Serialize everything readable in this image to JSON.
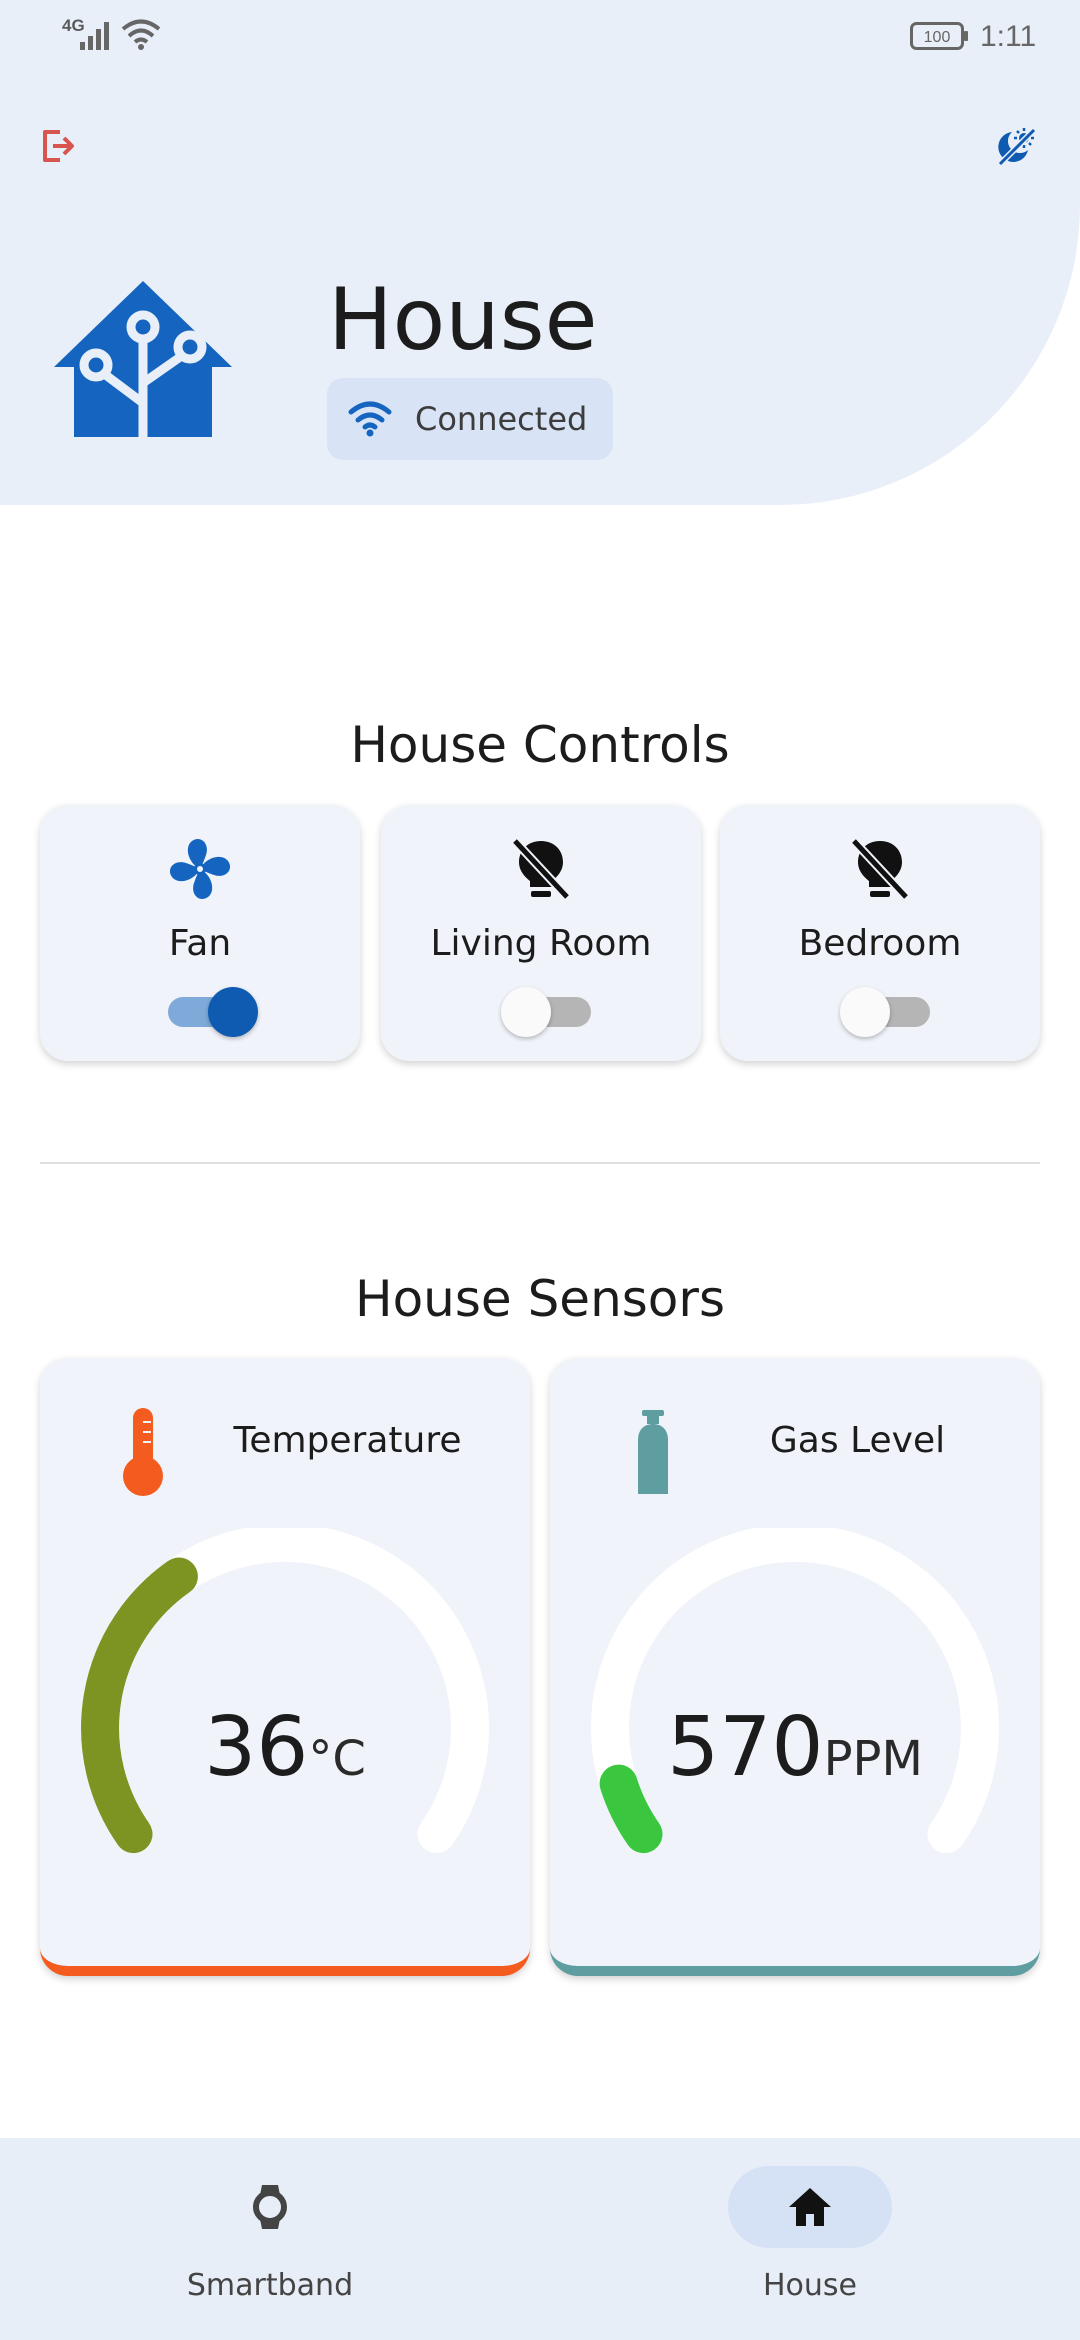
{
  "status_bar": {
    "network": "4G",
    "battery": "100",
    "time": "1:11"
  },
  "header": {
    "title": "House",
    "status": "Connected",
    "icons": {
      "logout": "logout-icon",
      "mode": "theme-mode-icon",
      "logo": "home-assistant-logo",
      "status": "wifi-icon"
    }
  },
  "controls": {
    "title": "House Controls",
    "items": [
      {
        "label": "Fan",
        "icon": "fan-icon",
        "state": "on"
      },
      {
        "label": "Living Room",
        "icon": "lightbulb-off-icon",
        "state": "off"
      },
      {
        "label": "Bedroom",
        "icon": "lightbulb-off-icon",
        "state": "off"
      }
    ]
  },
  "sensors": {
    "title": "House Sensors",
    "items": [
      {
        "label": "Temperature",
        "icon": "thermometer-icon",
        "value": "36",
        "unit": "°C",
        "accent": "#f45b1f",
        "arc_color": "#7d9322",
        "level": 0.36
      },
      {
        "label": "Gas Level",
        "icon": "gas-cylinder-icon",
        "value": "570",
        "unit": "PPM",
        "accent": "#5f9ea0",
        "arc_color": "#3ac73f",
        "level": 0.07
      }
    ]
  },
  "nav": {
    "items": [
      {
        "label": "Smartband",
        "icon": "watch-icon",
        "active": false
      },
      {
        "label": "House",
        "icon": "home-icon",
        "active": true
      }
    ]
  },
  "colors": {
    "primary": "#0f5bb2",
    "header_bg": "#e9eff8",
    "card_bg": "#f0f4fa",
    "logout": "#d9534f"
  }
}
